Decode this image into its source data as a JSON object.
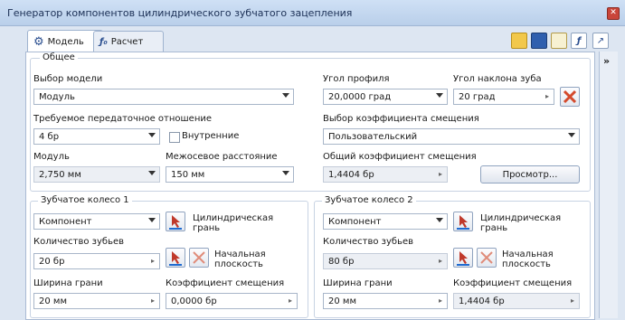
{
  "window": {
    "title": "Генератор компонентов цилиндрического зубчатого зацепления"
  },
  "tabs": [
    {
      "label": "Модель"
    },
    {
      "label": "Расчет"
    }
  ],
  "common": {
    "title": "Общее",
    "model_select": {
      "label": "Выбор модели",
      "value": "Модуль"
    },
    "ratio": {
      "label": "Требуемое передаточное отношение",
      "value": "4 бр"
    },
    "internal": {
      "label": "Внутренние",
      "checked": false
    },
    "module": {
      "label": "Модуль",
      "value": "2,750 мм"
    },
    "center_distance": {
      "label": "Межосевое расстояние",
      "value": "150 мм"
    },
    "pressure_angle": {
      "label": "Угол профиля",
      "value": "20,0000 град"
    },
    "helix_angle": {
      "label": "Угол наклона зуба",
      "value": "20 град"
    },
    "shift_select": {
      "label": "Выбор коэффициента смещения",
      "value": "Пользовательский"
    },
    "total_shift": {
      "label": "Общий коэффициент смещения",
      "value": "1,4404 бр"
    },
    "preview_button": "Просмотр..."
  },
  "gear1": {
    "title": "Зубчатое колесо 1",
    "type": {
      "value": "Компонент"
    },
    "cyl_face": "Цилиндрическая грань",
    "teeth": {
      "label": "Количество зубьев",
      "value": "20 бр"
    },
    "start_plane": "Начальная плоскость",
    "face_width": {
      "label": "Ширина грани",
      "value": "20 мм"
    },
    "shift": {
      "label": "Коэффициент смещения",
      "value": "0,0000 бр"
    }
  },
  "gear2": {
    "title": "Зубчатое колесо 2",
    "type": {
      "value": "Компонент"
    },
    "cyl_face": "Цилиндрическая грань",
    "teeth": {
      "label": "Количество зубьев",
      "value": "80 бр"
    },
    "start_plane": "Начальная плоскость",
    "face_width": {
      "label": "Ширина грани",
      "value": "20 мм"
    },
    "shift": {
      "label": "Коэффициент смещения",
      "value": "1,4404 бр"
    }
  },
  "icons": {
    "tab_model": "gear-model-icon",
    "tab_calc": "formula-icon",
    "toolbar": [
      "folder-open-icon",
      "save-icon",
      "table-icon",
      "formula-icon",
      "help-icon"
    ],
    "select": "select-arrow-icon",
    "clear": "clear-red-icon",
    "expand": "double-chevron-icon"
  },
  "colors": {
    "title_bg": "#c6d8ef",
    "panel_bg": "#ffffff",
    "accent": "#d44a2c"
  }
}
